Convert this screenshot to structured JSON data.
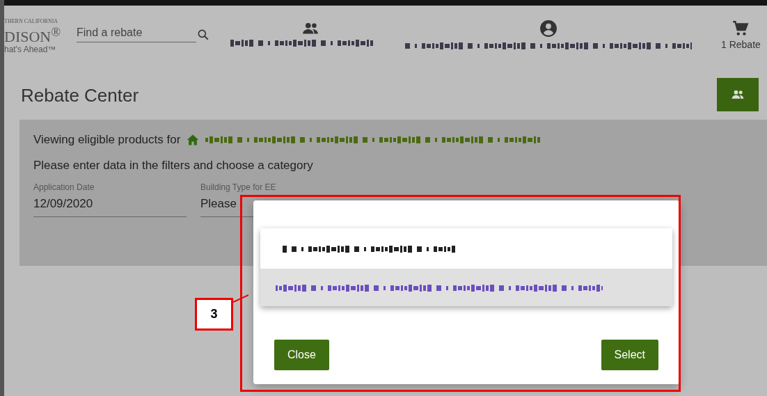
{
  "header": {
    "logo": {
      "line_1": "THERN CALIFORNIA",
      "line_2": "DISON$^{®}$",
      "line_3": "hat's Ahead™"
    },
    "search": {
      "placeholder": "Find a rebate"
    },
    "cart": {
      "label": "1 Rebate"
    }
  },
  "page_title": "Rebate Center",
  "eligibility": {
    "prefix": "Viewing eligible products for"
  },
  "instructions": "Please enter data in the filters and choose a category",
  "filters": [
    {
      "label": "Application Date",
      "value": "12/09/2020"
    },
    {
      "label": "Building Type for EE",
      "value": "Please"
    }
  ],
  "dialog": {
    "options": [
      {
        "selected": false
      },
      {
        "selected": true
      }
    ],
    "buttons": [
      "Close",
      "Select"
    ]
  },
  "callout": {
    "label": "3"
  }
}
